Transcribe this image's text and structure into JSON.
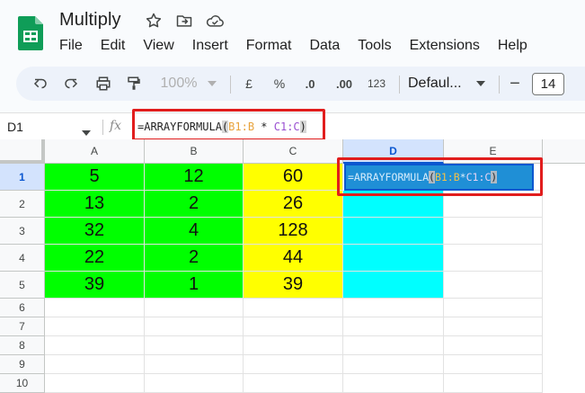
{
  "doc": {
    "title": "Multiply",
    "logo_color": "#0f9d58"
  },
  "menu": [
    "File",
    "Edit",
    "View",
    "Insert",
    "Format",
    "Data",
    "Tools",
    "Extensions",
    "Help"
  ],
  "toolbar": {
    "zoom": "100%",
    "currency": "£",
    "percent": "%",
    "dec_decrease": ".0",
    "dec_increase": ".00",
    "number_format": "123",
    "font": "Defaul...",
    "font_size": "14",
    "minus": "−"
  },
  "formula_bar": {
    "name_box": "D1",
    "fx": "fx",
    "formula_prefix": "=ARRAYFORMULA",
    "open_paren": "(",
    "range1": "B1:B",
    "operator": " * ",
    "range2": "C1:C",
    "close_paren": ")"
  },
  "grid": {
    "columns": [
      "A",
      "B",
      "C",
      "D",
      "E"
    ],
    "rows": [
      "1",
      "2",
      "3",
      "4",
      "5",
      "6",
      "7",
      "8",
      "9",
      "10"
    ],
    "selected_column": "D",
    "selected_row": "1",
    "data": [
      [
        "5",
        "12",
        "60"
      ],
      [
        "13",
        "2",
        "26"
      ],
      [
        "32",
        "4",
        "128"
      ],
      [
        "22",
        "2",
        "44"
      ],
      [
        "39",
        "1",
        "39"
      ]
    ],
    "colors": {
      "A": "#00ff00",
      "B": "#00ff00",
      "C": "#ffff00",
      "D": "#00ffff"
    },
    "highlight_color": "#e11d1d"
  }
}
